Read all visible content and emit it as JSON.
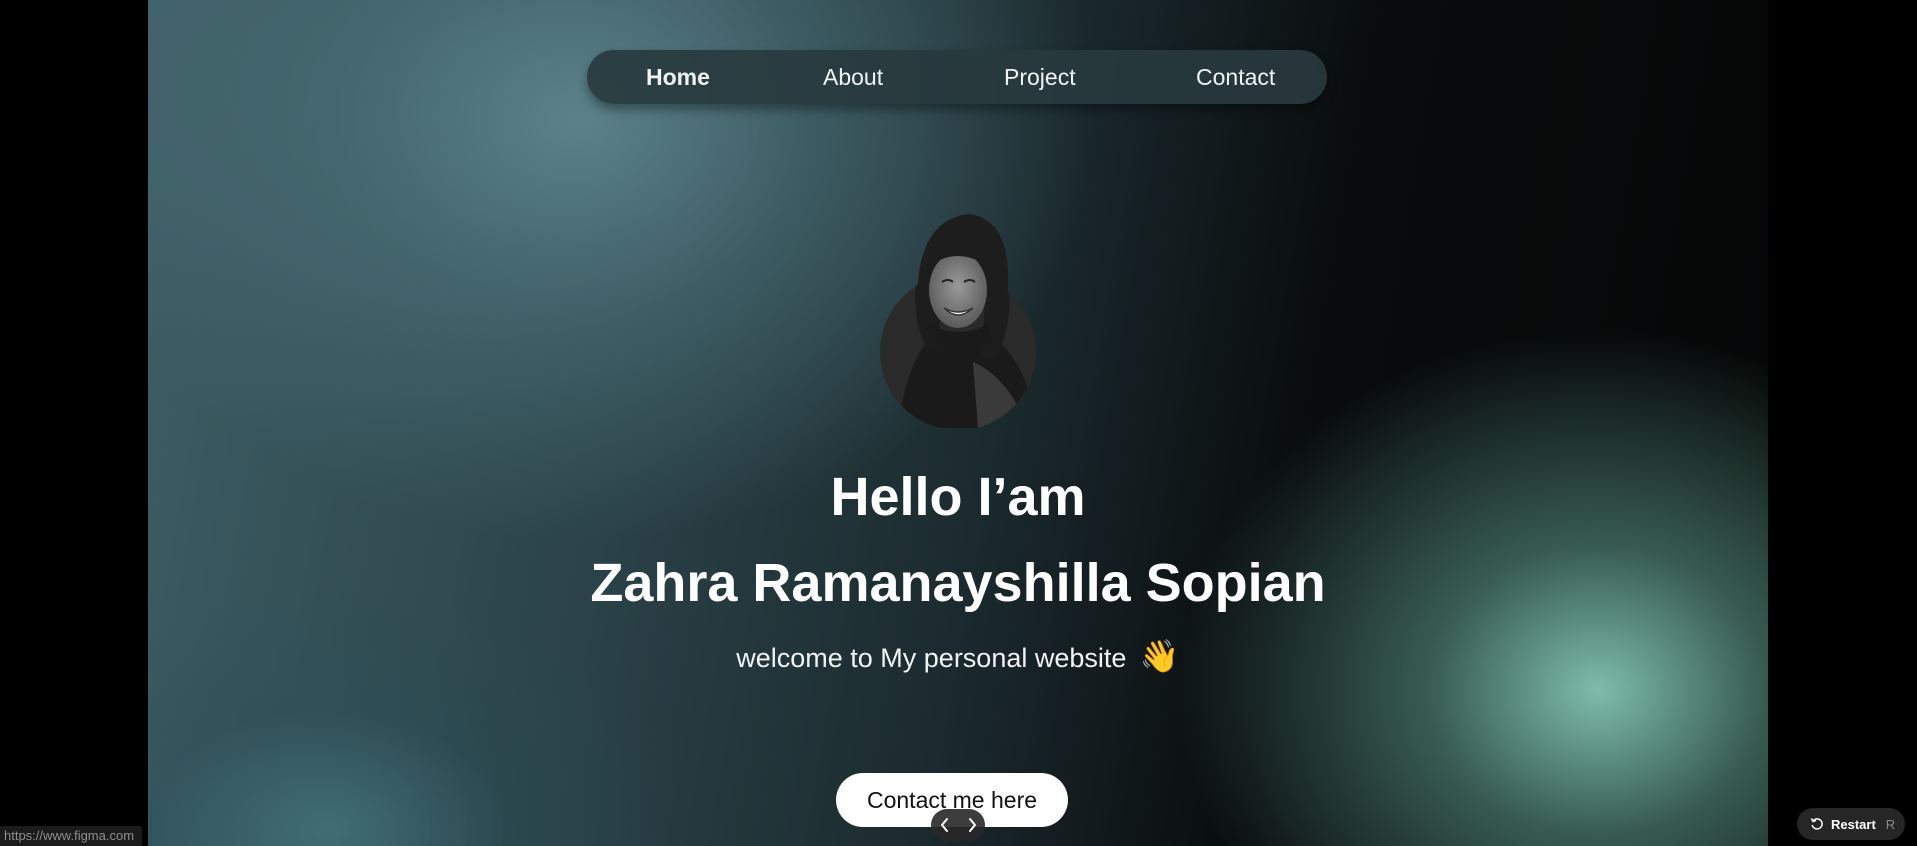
{
  "nav": {
    "items": [
      {
        "label": "Home",
        "active": true
      },
      {
        "label": "About",
        "active": false
      },
      {
        "label": "Project",
        "active": false
      },
      {
        "label": "Contact",
        "active": false
      }
    ]
  },
  "hero": {
    "greeting": "Hello I’am",
    "name": "Zahra Ramanayshilla Sopian",
    "tagline": "welcome to My personal website",
    "wave_emoji": "👋",
    "cta_label": "Contact me here"
  },
  "player": {
    "restart_label": "Restart",
    "restart_key": "R",
    "prev_icon": "chevron-left-icon",
    "next_icon": "chevron-right-icon"
  },
  "status_bar": {
    "url": "https://www.figma.com"
  },
  "colors": {
    "accent_teal": "#84c6b2",
    "nav_bg": "#283a3e",
    "text": "#ffffff"
  }
}
